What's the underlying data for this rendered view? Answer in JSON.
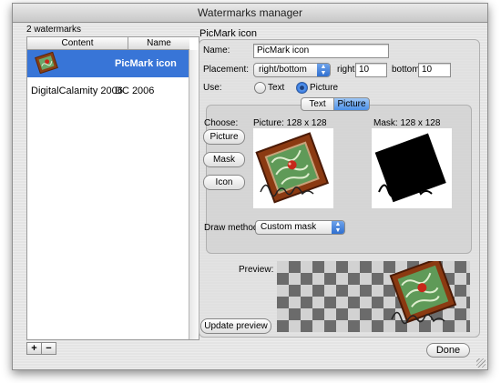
{
  "window": {
    "title": "Watermarks manager"
  },
  "list": {
    "count_label": "2 watermarks",
    "columns": [
      "Content",
      "Name"
    ],
    "rows": [
      {
        "content": "",
        "name": "PicMark icon",
        "selected": true
      },
      {
        "content": "DigitalCalamity 2006",
        "name": "DC 2006",
        "selected": false
      }
    ],
    "add_label": "+",
    "remove_label": "−"
  },
  "detail": {
    "header": "PicMark icon",
    "name_label": "Name:",
    "name_value": "PicMark icon",
    "placement_label": "Placement:",
    "placement_value": "right/bottom",
    "right_label": "right",
    "right_value": "10",
    "bottom_label": "bottom",
    "bottom_value": "10",
    "use_label": "Use:",
    "use_text": "Text",
    "use_picture": "Picture",
    "use_selected": "Picture",
    "tabs": [
      "Text",
      "Picture"
    ],
    "active_tab": "Picture",
    "choose_label": "Choose:",
    "picture_button": "Picture",
    "mask_button": "Mask",
    "icon_button": "Icon",
    "picture_caption": "Picture: 128 x 128",
    "mask_caption": "Mask: 128 x 128",
    "draw_method_label": "Draw method:",
    "draw_method_value": "Custom mask",
    "preview_label": "Preview:",
    "update_preview_button": "Update preview"
  },
  "footer": {
    "done_button": "Done"
  },
  "colors": {
    "selection": "#3875d7",
    "accent": "#4d91e8"
  }
}
